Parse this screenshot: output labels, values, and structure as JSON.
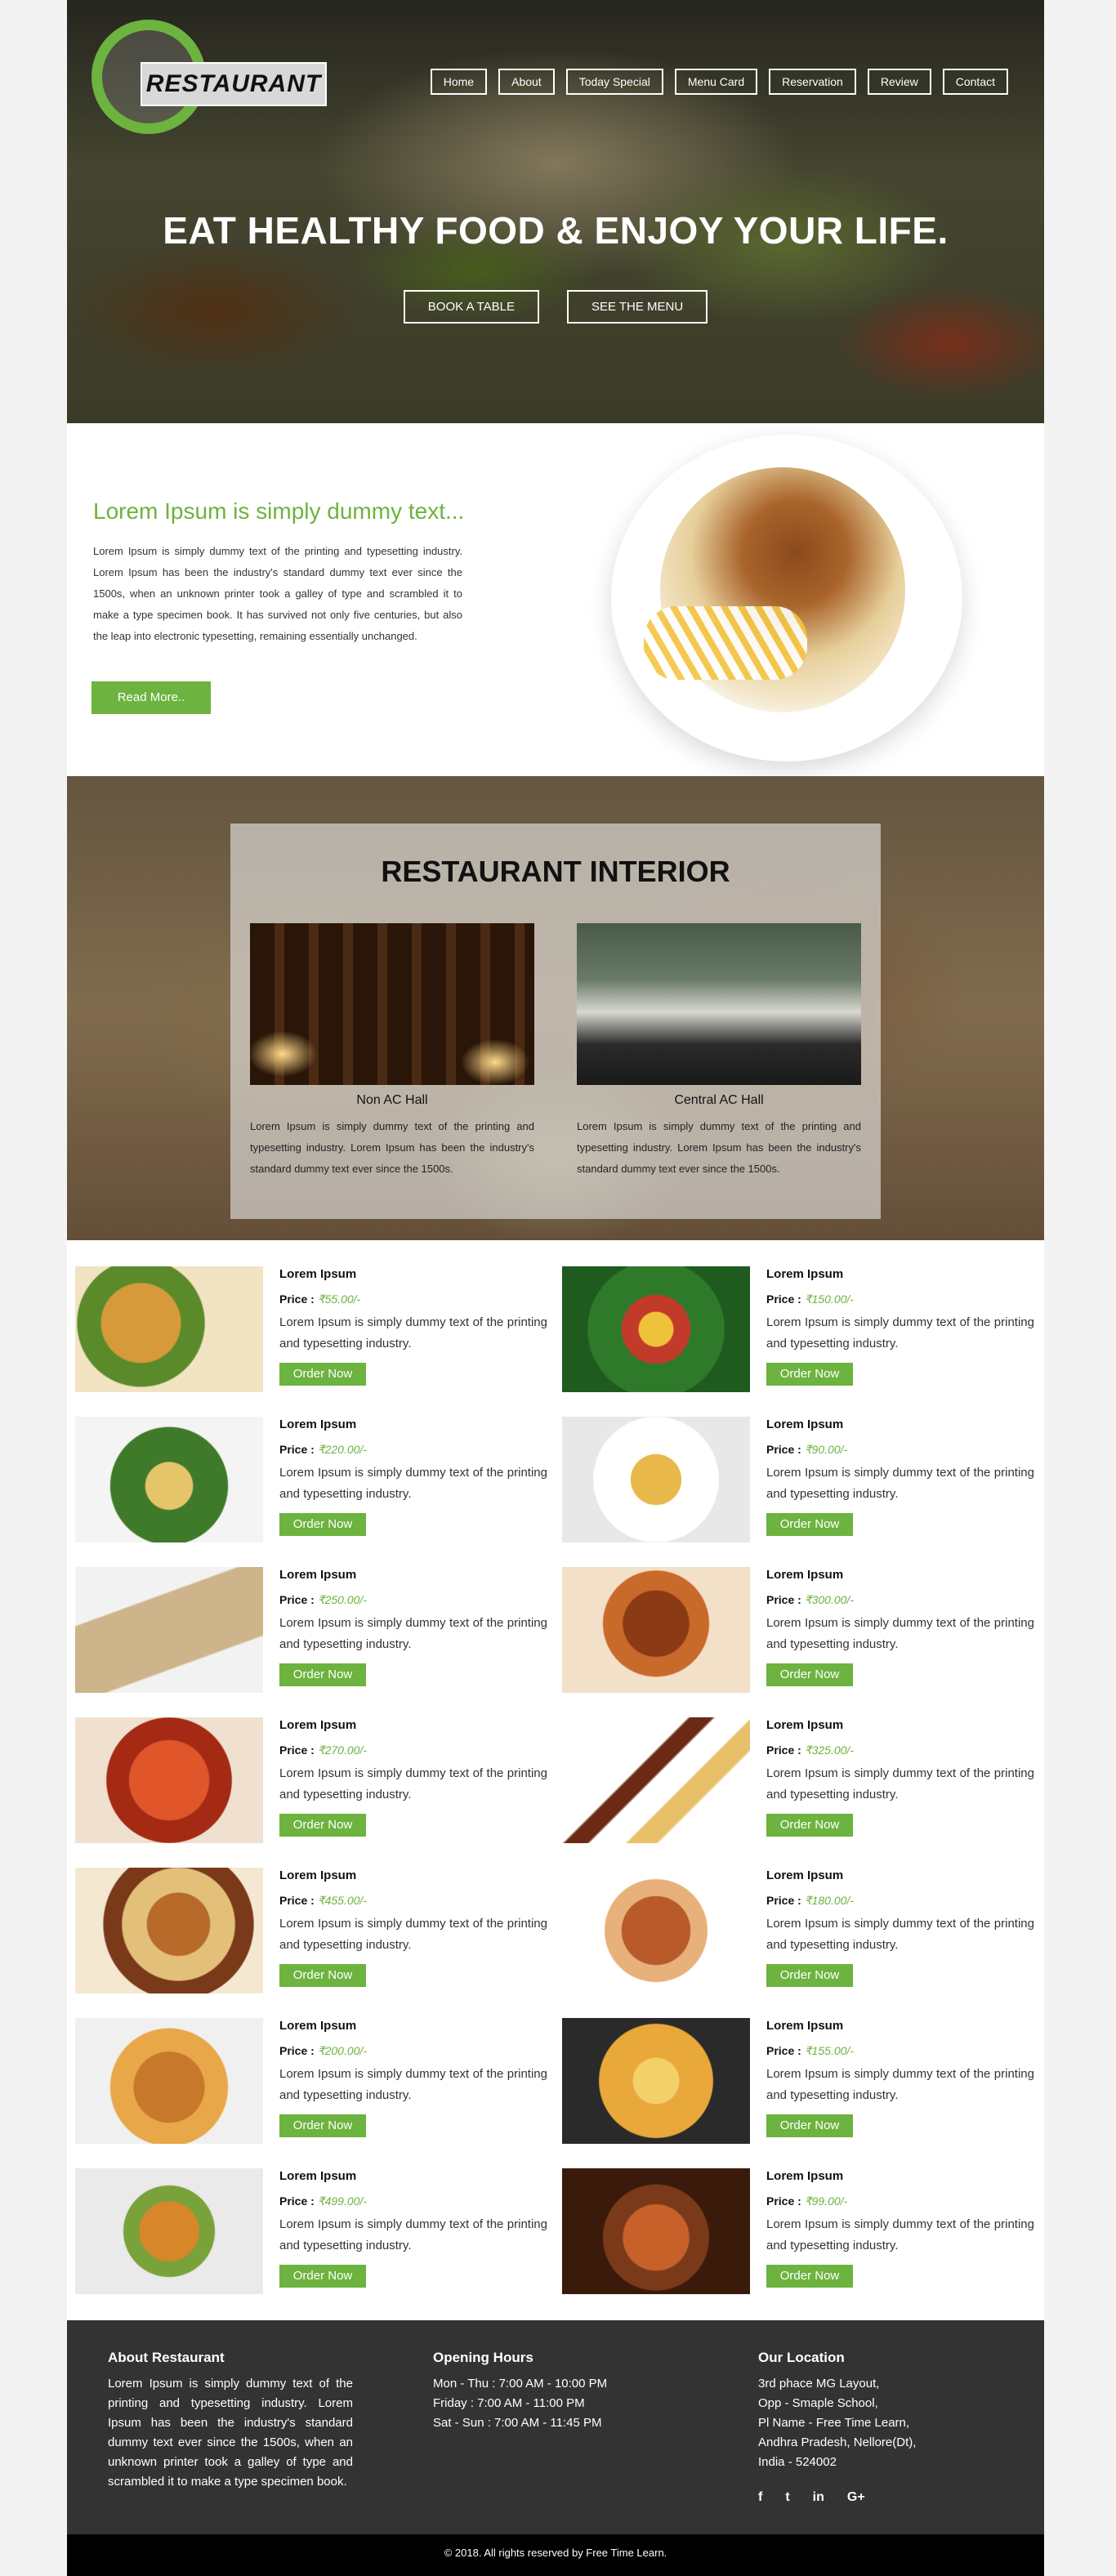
{
  "brand": {
    "logo_text": "RESTAURANT",
    "accent": "#6db33f"
  },
  "nav": [
    "Home",
    "About",
    "Today Special",
    "Menu Card",
    "Reservation",
    "Review",
    "Contact"
  ],
  "hero": {
    "headline": "EAT HEALTHY FOOD & ENJOY YOUR LIFE.",
    "btn_book": "BOOK A TABLE",
    "btn_menu": "SEE THE MENU"
  },
  "about": {
    "title": "Lorem Ipsum is simply dummy text...",
    "text": "Lorem Ipsum is simply dummy text of the printing and typesetting industry. Lorem Ipsum has been the industry's standard dummy text ever since the 1500s, when an unknown printer took a galley of type and scrambled it to make a type specimen book. It has survived not only five centuries, but also the leap into electronic typesetting, remaining essentially unchanged.",
    "button": "Read More.."
  },
  "interior": {
    "title": "RESTAURANT INTERIOR",
    "halls": [
      {
        "name": "Non AC Hall",
        "text": "Lorem Ipsum is simply dummy text of the printing and typesetting industry. Lorem Ipsum has been the industry's standard dummy text ever since the 1500s."
      },
      {
        "name": "Central AC Hall",
        "text": "Lorem Ipsum is simply dummy text of the printing and typesetting industry. Lorem Ipsum has been the industry's standard dummy text ever since the 1500s."
      }
    ]
  },
  "menu": {
    "price_label": "Price :",
    "order_label": "Order Now",
    "item_name": "Lorem Ipsum",
    "item_desc": "Lorem Ipsum is simply dummy text of the printing and typesetting industry.",
    "left_prices": [
      "₹55.00/-",
      "₹220.00/-",
      "₹250.00/-",
      "₹270.00/-",
      "₹455.00/-",
      "₹200.00/-",
      "₹499.00/-"
    ],
    "right_prices": [
      "₹150.00/-",
      "₹90.00/-",
      "₹300.00/-",
      "₹325.00/-",
      "₹180.00/-",
      "₹155.00/-",
      "₹99.00/-"
    ]
  },
  "footer": {
    "about_title": "About Restaurant",
    "about_text": "Lorem Ipsum is simply dummy text of the printing and typesetting industry. Lorem Ipsum has been the industry's standard dummy text ever since the 1500s, when an unknown printer took a galley of type and scrambled it to make a type specimen book.",
    "hours_title": "Opening Hours",
    "hours": [
      "Mon - Thu : 7:00 AM - 10:00 PM",
      "Friday : 7:00 AM - 11:00 PM",
      "Sat - Sun : 7:00 AM - 11:45 PM"
    ],
    "location_title": "Our Location",
    "location": [
      "3rd phace MG Layout,",
      "Opp - Smaple School,",
      "Pl Name - Free Time Learn,",
      "Andhra Pradesh, Nellore(Dt),",
      "India - 524002"
    ],
    "social": [
      "f",
      "t",
      "in",
      "G+"
    ],
    "copyright": "© 2018. All rights reserved by Free Time Learn."
  }
}
